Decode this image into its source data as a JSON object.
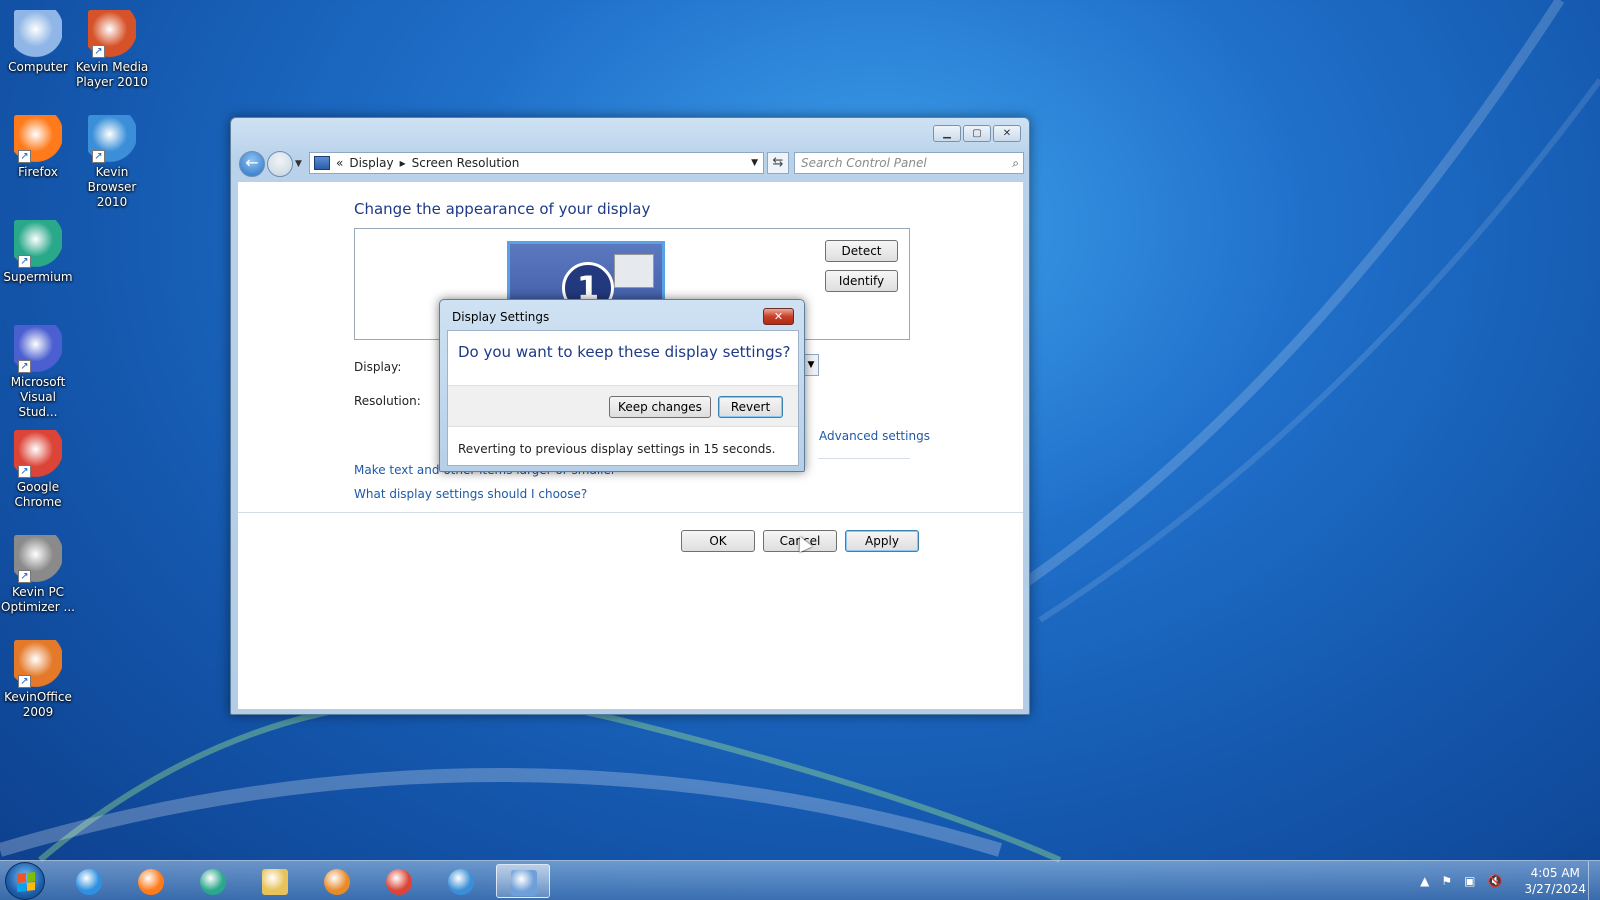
{
  "desktop": {
    "icons": [
      {
        "name": "desktop-icon-computer",
        "label": "Computer",
        "icon": "computer-icon",
        "color": "#8fb6e6"
      },
      {
        "name": "desktop-icon-kevin-media-player",
        "label": "Kevin Media Player 2010",
        "icon": "media-player-icon",
        "color": "#d6532a"
      },
      {
        "name": "desktop-icon-firefox",
        "label": "Firefox",
        "icon": "firefox-icon",
        "color": "#ff7a1a"
      },
      {
        "name": "desktop-icon-kevin-browser",
        "label": "Kevin Browser 2010",
        "icon": "globe-icon",
        "color": "#3a8fd8"
      },
      {
        "name": "desktop-icon-supermium",
        "label": "Supermium",
        "icon": "supermium-icon",
        "color": "#2aa88a"
      },
      {
        "name": "desktop-icon-visual-studio",
        "label": "Microsoft Visual Stud...",
        "icon": "visual-studio-icon",
        "color": "#4b5fd0"
      },
      {
        "name": "desktop-icon-google-chrome",
        "label": "Google Chrome",
        "icon": "chrome-icon",
        "color": "#db4437"
      },
      {
        "name": "desktop-icon-kevin-pc-optimizer",
        "label": "Kevin PC Optimizer ...",
        "icon": "speedometer-icon",
        "color": "#8a8a8a"
      },
      {
        "name": "desktop-icon-kevin-office",
        "label": "KevinOffice 2009",
        "icon": "office-icon",
        "color": "#e4792a"
      }
    ]
  },
  "window": {
    "caption_buttons": {
      "minimize": "▁",
      "maximize": "▢",
      "close": "✕"
    },
    "address": {
      "overflow": "«",
      "crumb1": "Display",
      "sep": "▸",
      "crumb2": "Screen Resolution"
    },
    "search": {
      "placeholder": "Search Control Panel"
    },
    "content": {
      "heading": "Change the appearance of your display",
      "monitor_number": "1",
      "detect_label": "Detect",
      "identify_label": "Identify",
      "display_label": "Display:",
      "resolution_label": "Resolution:",
      "advanced_link": "Advanced settings",
      "text_size_link": "Make text and other items larger or smaller",
      "help_link": "What display settings should I choose?",
      "ok_label": "OK",
      "cancel_label": "Cancel",
      "apply_label": "Apply"
    }
  },
  "dialog": {
    "title": "Display Settings",
    "close_glyph": "✕",
    "question": "Do you want to keep these display settings?",
    "keep_label": "Keep changes",
    "revert_label": "Revert",
    "note": "Reverting to previous display settings in 15 seconds."
  },
  "taskbar": {
    "items": [
      {
        "name": "taskbar-ie",
        "icon": "internet-explorer-icon",
        "color": "#2f8fe0"
      },
      {
        "name": "taskbar-firefox",
        "icon": "firefox-icon",
        "color": "#ff7a1a"
      },
      {
        "name": "taskbar-supermium",
        "icon": "supermium-icon",
        "color": "#2aa88a"
      },
      {
        "name": "taskbar-explorer",
        "icon": "folder-icon",
        "color": "#e8c25a"
      },
      {
        "name": "taskbar-media-player",
        "icon": "media-player-icon",
        "color": "#e88a2a"
      },
      {
        "name": "taskbar-chrome",
        "icon": "chrome-icon",
        "color": "#db4437"
      },
      {
        "name": "taskbar-kevin-browser",
        "icon": "globe-icon",
        "color": "#3a8fd8"
      },
      {
        "name": "taskbar-control-panel",
        "icon": "display-settings-icon",
        "color": "#6f9fd8",
        "active": true
      }
    ],
    "tray": {
      "up": "▲",
      "flag": "⚑",
      "network": "▣",
      "volume": "🔇"
    },
    "clock": {
      "time": "4:05 AM",
      "date": "3/27/2024"
    }
  }
}
